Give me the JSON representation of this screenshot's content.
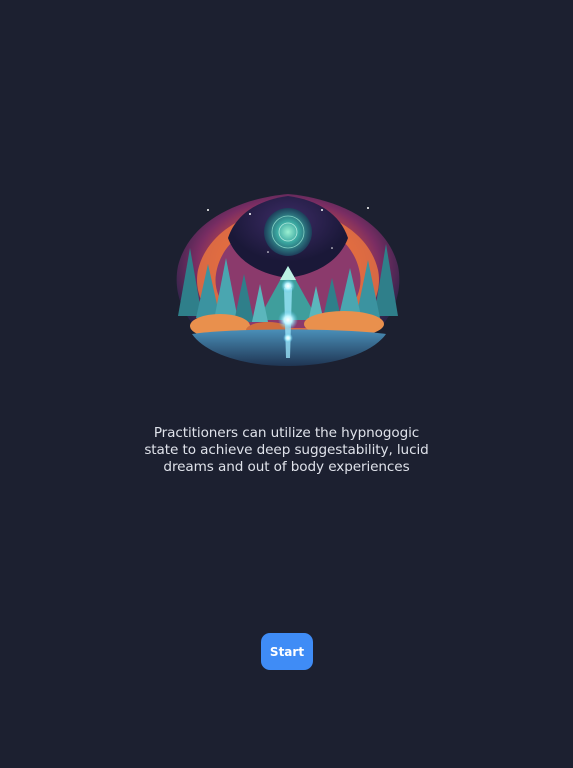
{
  "onboarding": {
    "illustration_icon": "mystic-forest-orb-illustration",
    "description": "Practitioners can utilize the hypnogogic state to achieve deep suggestability, lucid dreams and out of body experiences",
    "start_label": "Start"
  },
  "colors": {
    "background": "#1c2030",
    "button": "#3f8cf6",
    "text": "#dfe2ea"
  }
}
